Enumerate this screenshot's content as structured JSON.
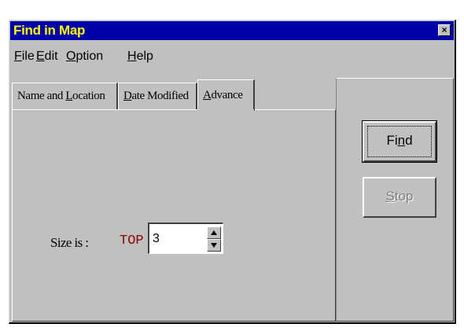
{
  "window": {
    "title": "Find in Map",
    "close_glyph": "×",
    "colors": {
      "titlebar": "#0000a8",
      "title_text": "#ffff00",
      "face": "#c0c0c0"
    }
  },
  "menu": {
    "items": [
      {
        "mnemonic": "F",
        "rest": "ile"
      },
      {
        "mnemonic": "E",
        "rest": "dit"
      },
      {
        "mnemonic": "O",
        "rest": "ption"
      },
      {
        "mnemonic": "H",
        "rest": "elp"
      }
    ]
  },
  "tabs": [
    {
      "pre": "Name and ",
      "mnemonic": "L",
      "rest": "ocation",
      "active": false
    },
    {
      "pre": "",
      "mnemonic": "D",
      "rest": "ate Modified",
      "active": false
    },
    {
      "pre": "",
      "mnemonic": "A",
      "rest": "dvance",
      "active": true
    }
  ],
  "advance": {
    "size_label": "Size is :",
    "qualifier": "TOP",
    "qualifier_color": "#8b0000",
    "value": "3"
  },
  "buttons": {
    "find": {
      "pre": "Fi",
      "mnemonic": "n",
      "rest": "d"
    },
    "stop": {
      "pre": "",
      "mnemonic": "S",
      "rest": "top",
      "disabled": true
    }
  }
}
